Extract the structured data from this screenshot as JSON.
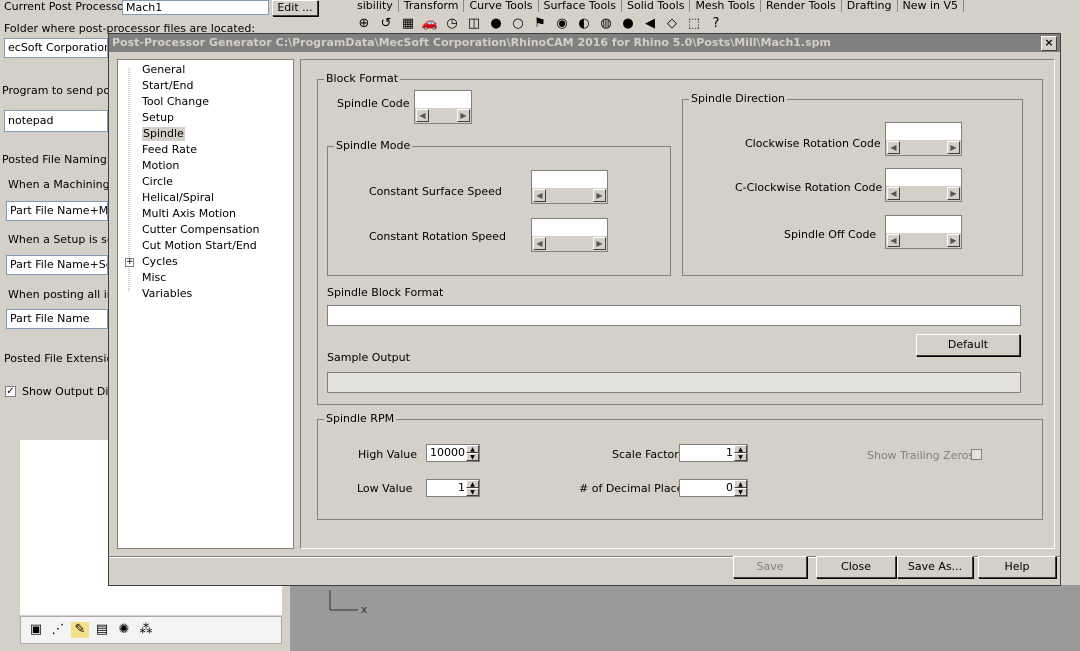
{
  "background_app": {
    "ribbon_tabs": [
      "sibility",
      "Transform",
      "Curve Tools",
      "Surface Tools",
      "Solid Tools",
      "Mesh Tools",
      "Render Tools",
      "Drafting",
      "New in V5"
    ],
    "current_post_processor_label": "Current Post Processor:",
    "current_post_processor_value": "Mach1",
    "edit_button": "Edit ...",
    "folder_label": "Folder where post-processor files are located:",
    "folder_value": "ecSoft Corporation\\R",
    "program_label": "Program to send poste",
    "program_value": "notepad",
    "naming_label": "Posted File Naming Co",
    "when_machining_label": "When a Machining O",
    "when_machining_value": "Part File Name+Mac",
    "when_setup_label": "When a Setup is sele",
    "when_setup_value": "Part File Name+Setu",
    "when_posting_label": "When posting all in fi",
    "when_posting_value": "Part File Name",
    "extension_label": "Posted File Extension",
    "show_output_label": "Show Output Dial",
    "show_output_checked": true,
    "viewport_axis_label": "x"
  },
  "dialog": {
    "title": "Post-Processor Generator   C:\\ProgramData\\MecSoft Corporation\\RhinoCAM 2016 for Rhino 5.0\\Posts\\Mill\\Mach1.spm",
    "close_label": "×",
    "tree": [
      {
        "label": "General",
        "selected": false,
        "expandable": false
      },
      {
        "label": "Start/End",
        "selected": false,
        "expandable": false
      },
      {
        "label": "Tool Change",
        "selected": false,
        "expandable": false
      },
      {
        "label": "Setup",
        "selected": false,
        "expandable": false
      },
      {
        "label": "Spindle",
        "selected": true,
        "expandable": false
      },
      {
        "label": "Feed Rate",
        "selected": false,
        "expandable": false
      },
      {
        "label": "Motion",
        "selected": false,
        "expandable": false
      },
      {
        "label": "Circle",
        "selected": false,
        "expandable": false
      },
      {
        "label": "Helical/Spiral",
        "selected": false,
        "expandable": false
      },
      {
        "label": "Multi Axis Motion",
        "selected": false,
        "expandable": false
      },
      {
        "label": "Cutter Compensation",
        "selected": false,
        "expandable": false
      },
      {
        "label": "Cut Motion Start/End",
        "selected": false,
        "expandable": false
      },
      {
        "label": "Cycles",
        "selected": false,
        "expandable": true
      },
      {
        "label": "Misc",
        "selected": false,
        "expandable": false
      },
      {
        "label": "Variables",
        "selected": false,
        "expandable": false
      }
    ],
    "block_format": {
      "title": "Block  Format",
      "spindle_code_label": "Spindle Code",
      "spindle_mode": {
        "title": "Spindle Mode",
        "constant_surface_speed_label": "Constant Surface Speed",
        "constant_rotation_speed_label": "Constant Rotation Speed"
      },
      "spindle_direction": {
        "title": "Spindle Direction",
        "clockwise_label": "Clockwise Rotation Code",
        "cclockwise_label": "C-Clockwise Rotation Code",
        "off_label": "Spindle Off Code"
      },
      "spindle_block_format_label": "Spindle Block Format",
      "spindle_block_format_value": "",
      "default_button": "Default",
      "sample_output_label": "Sample Output",
      "sample_output_value": ""
    },
    "spindle_rpm": {
      "title": "Spindle RPM",
      "high_value_label": "High Value",
      "high_value": "10000",
      "low_value_label": "Low Value",
      "low_value": "1",
      "scale_factor_label": "Scale Factor",
      "scale_factor": "1",
      "decimal_places_label": "# of Decimal Places",
      "decimal_places": "0",
      "trailing_zeros_label": "Show Trailing Zeros",
      "trailing_zeros_checked": false
    },
    "buttons": {
      "save": "Save",
      "close": "Close",
      "save_as": "Save As...",
      "help": "Help"
    }
  }
}
